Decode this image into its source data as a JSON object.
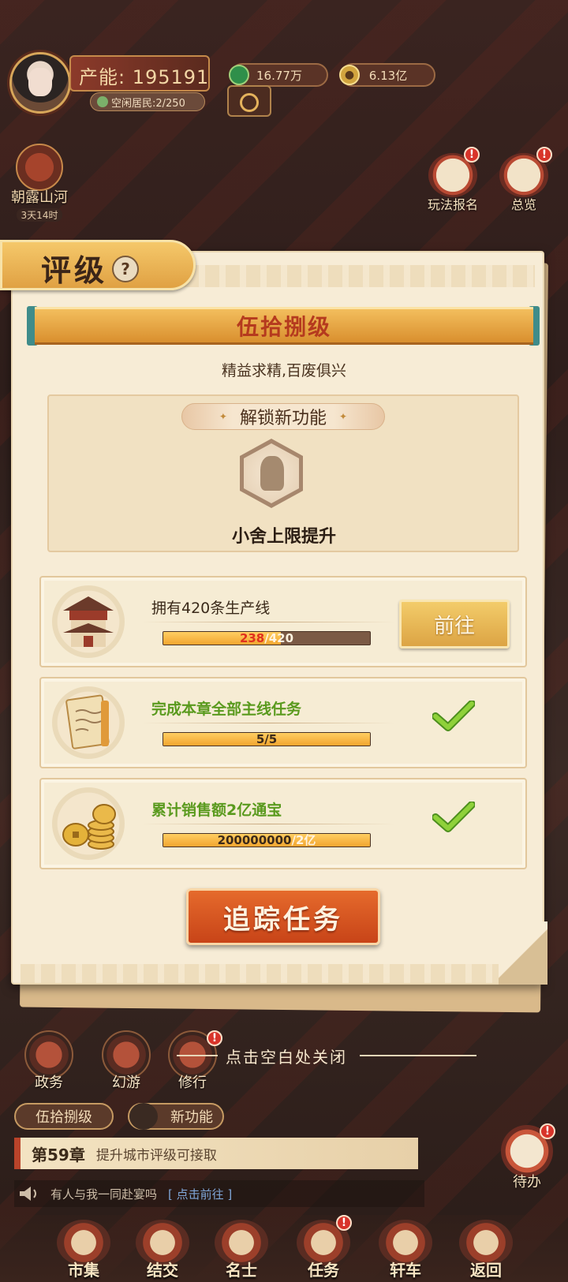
{
  "hud": {
    "power_label": "产能: 195191",
    "idle_residents": "空闲居民:2/250",
    "currency_1": "16.77万",
    "currency_2": "6.13亿"
  },
  "event": {
    "title": "朝露山河",
    "timer": "3天14时"
  },
  "side_buttons": [
    {
      "label": "玩法报名",
      "badge": "!"
    },
    {
      "label": "总览",
      "badge": "!"
    }
  ],
  "panel": {
    "tab_title": "评级",
    "help": "?",
    "level_name": "伍拾捌级",
    "motto": "精益求精,百废俱兴",
    "unlock_title": "解锁新功能",
    "unlock_star": "✦",
    "unlock_feature": "小舍上限提升",
    "tasks": [
      {
        "label": "拥有420条生产线",
        "current": "238",
        "sep_total": "/420",
        "progress": 0.567,
        "action": "前往",
        "done": false
      },
      {
        "label": "完成本章全部主线任务",
        "current": "5",
        "sep_total": "/5",
        "progress": 1.0,
        "done": true
      },
      {
        "label": "累计销售额2亿通宝",
        "current": "200000000",
        "sep_total": "/2亿",
        "progress": 1.0,
        "done": true
      }
    ],
    "track_button": "追踪任务"
  },
  "close_hint": "点击空白处关闭",
  "mini_buttons": [
    {
      "label": "政务"
    },
    {
      "label": "幻游"
    },
    {
      "label": "修行",
      "badge": "!"
    }
  ],
  "level_tag": "伍拾捌级",
  "new_feature_tag": "新功能",
  "chapter": {
    "number": "第59章",
    "desc": "提升城市评级可接取"
  },
  "chat": {
    "message": "有人与我一同赴宴吗",
    "link": "[ 点击前往 ]"
  },
  "todo": {
    "label": "待办",
    "badge": "!"
  },
  "nav": [
    {
      "label": "市集"
    },
    {
      "label": "结交"
    },
    {
      "label": "名士"
    },
    {
      "label": "任务",
      "badge": "!"
    },
    {
      "label": "轩车"
    },
    {
      "label": "返回"
    }
  ],
  "colors": {
    "accent": "#d98f2e",
    "primary_button": "#c84418",
    "check": "#6fbf2a",
    "progress_fill": "#f2a52f"
  }
}
